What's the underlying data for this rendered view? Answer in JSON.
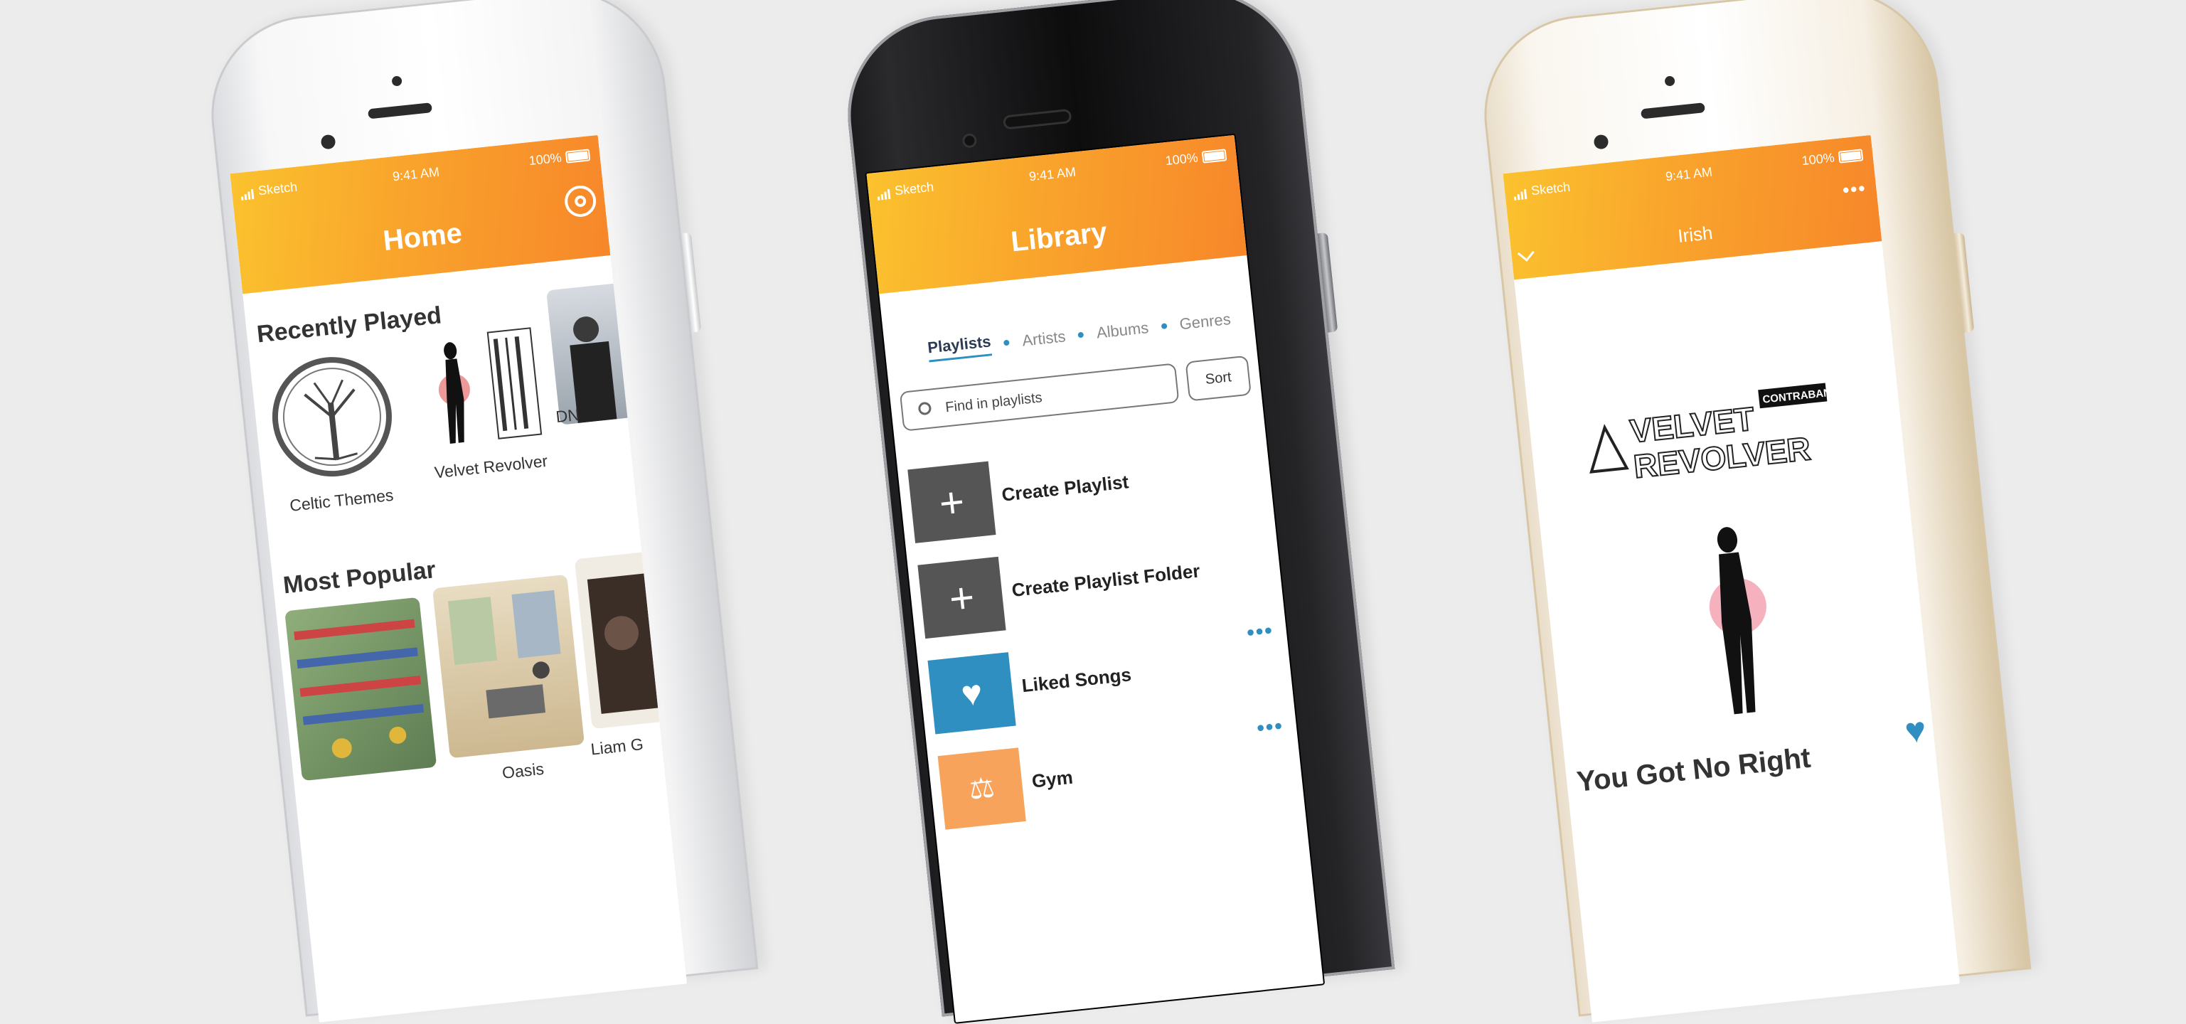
{
  "status": {
    "carrier": "Sketch",
    "time": "9:41 AM",
    "battery": "100%"
  },
  "home": {
    "title": "Home",
    "recently_played_title": "Recently Played",
    "recently_played": [
      "Celtic Themes",
      "Velvet Revolver",
      "DN"
    ],
    "most_popular_title": "Most Popular",
    "most_popular": [
      "",
      "Oasis",
      "Liam G"
    ]
  },
  "library": {
    "title": "Library",
    "tabs": [
      "Playlists",
      "Artists",
      "Albums",
      "Genres"
    ],
    "search_placeholder": "Find in playlists",
    "sort_label": "Sort",
    "rows": [
      {
        "label": "Create Playlist",
        "icon": "plus-icon"
      },
      {
        "label": "Create Playlist Folder",
        "icon": "plus-icon"
      },
      {
        "label": "Liked Songs",
        "icon": "heart-icon"
      },
      {
        "label": "Gym",
        "icon": "dumbbell-icon"
      }
    ],
    "more_label": "•••"
  },
  "player": {
    "title": "Irish",
    "more_label": "•••",
    "song_title": "You Got No Right",
    "logo_line1": "VELVET",
    "logo_line2": "REVOLVER",
    "logo_tag": "CONTRABAND"
  },
  "colors": {
    "accent": "#f9a42c",
    "brand_blue": "#2f8fc1"
  }
}
